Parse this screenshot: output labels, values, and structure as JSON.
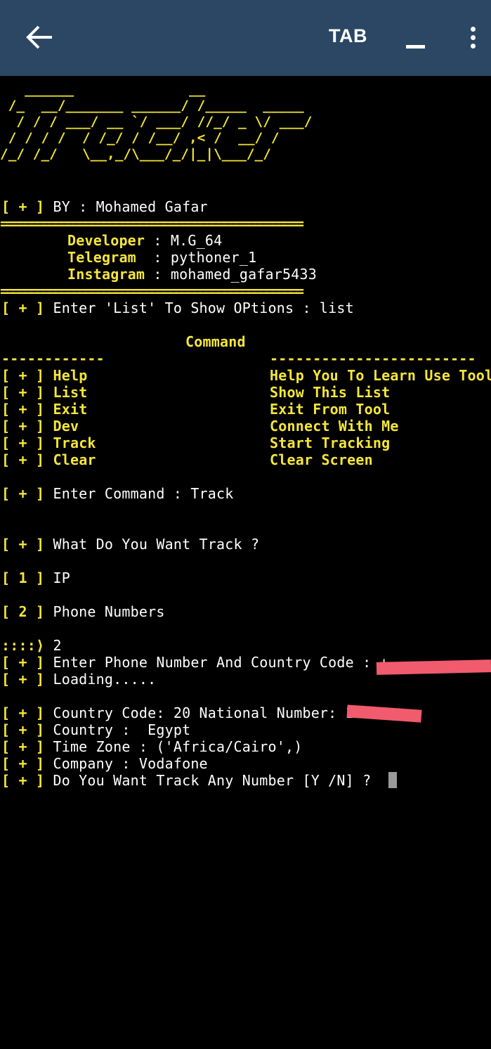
{
  "appbar": {
    "tab_label": "TAB"
  },
  "logo": {
    "lines": [
      "   ______              __",
      " /_  __/_______ ______/ /_____  _____",
      "  / / / ___/ __ `/ ___/ //_/ _ \\/ ___/",
      " / / / /  / /_/ / /__/ ,< /  __/ /",
      "/_/ /_/   \\__,_/\\___/_/|_|\\___/_/"
    ]
  },
  "terminal": {
    "prompt": "[ + ]",
    "by_text": " BY : Mohamed Gafar",
    "separator": "==================================================",
    "dev_label": "Developer",
    "dev_value": " : M.G_64",
    "tg_label": "Telegram ",
    "tg_value": " : pythoner_1",
    "ig_label": "Instagram",
    "ig_value": " : mohamed_gafar5433",
    "enter_list_text": " Enter 'List' To Show OPtions : list",
    "command_title": "Command",
    "left_dashes": "------------",
    "right_dashes": "------------------------",
    "commands": [
      {
        "name": "Help",
        "desc": "Help You To Learn Use Tool"
      },
      {
        "name": "List",
        "desc": "Show This List"
      },
      {
        "name": "Exit",
        "desc": "Exit From Tool"
      },
      {
        "name": "Dev",
        "desc": "Connect With Me"
      },
      {
        "name": "Track",
        "desc": "Start Tracking"
      },
      {
        "name": "Clear",
        "desc": "Clear Screen"
      }
    ],
    "enter_command_text": " Enter Command : Track",
    "what_track_text": " What Do You Want Track ?",
    "opt1_num": "[ 1 ]",
    "opt1_text": " IP",
    "opt2_num": "[ 2 ]",
    "opt2_text": " Phone Numbers",
    "choice_prompt": "::::⟩",
    "choice_value": " 2",
    "enter_phone_text": " Enter Phone Number And Country Code : +",
    "loading_text": " Loading.....",
    "country_code_text": " Country Code: 20 National Number: 1",
    "country_text": " Country :  Egypt",
    "timezone_text": " Time Zone : ('Africa/Cairo',)",
    "company_text": " Company : Vodafone",
    "again_text": " Do You Want Track Any Number [Y /N] ?  "
  }
}
